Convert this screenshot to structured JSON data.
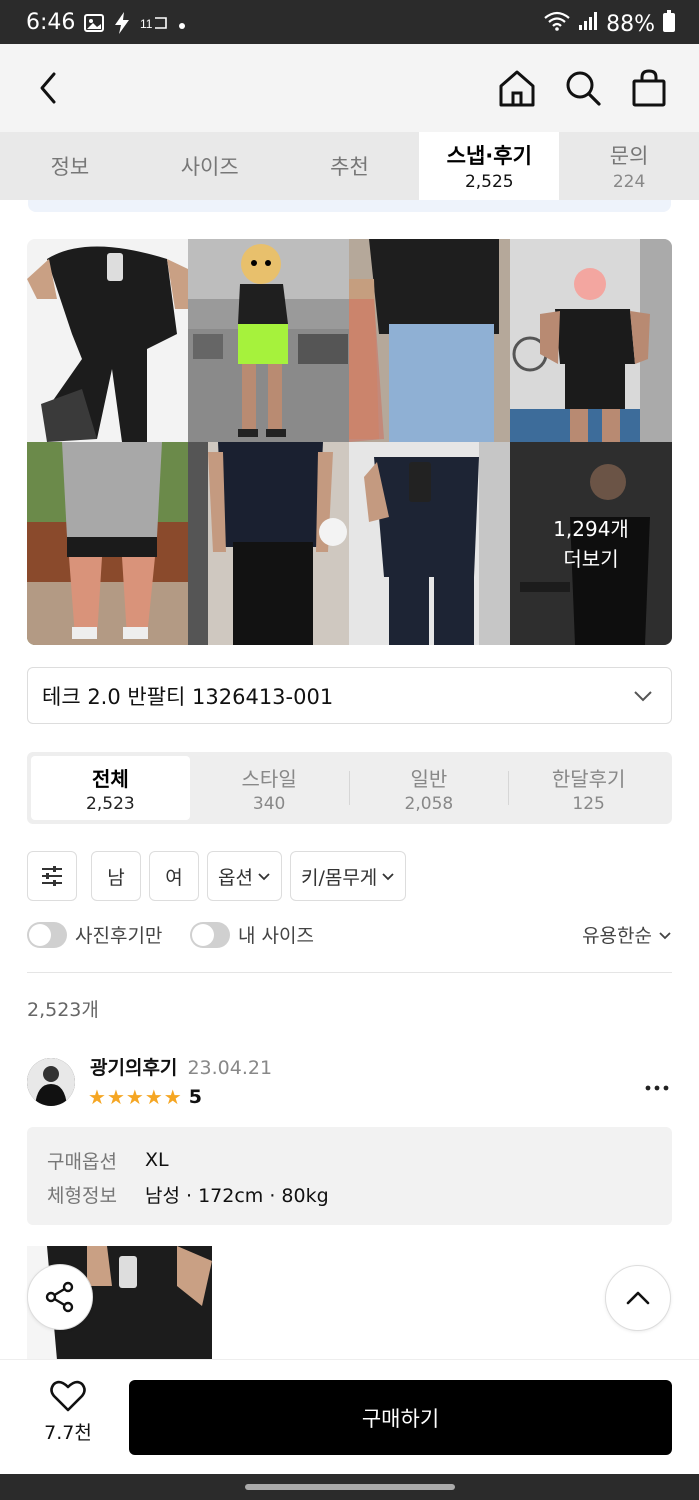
{
  "status_bar": {
    "time": "6:46",
    "battery": "88%",
    "left_icons": [
      "image-icon",
      "bolt-icon",
      "11st-icon",
      "dot-icon"
    ],
    "right_icons": [
      "wifi-icon",
      "signal-icon",
      "battery-icon"
    ]
  },
  "header": {
    "icons": [
      "back-icon",
      "home-icon",
      "search-icon",
      "bag-icon"
    ]
  },
  "tabs": [
    {
      "label": "정보",
      "count": ""
    },
    {
      "label": "사이즈",
      "count": ""
    },
    {
      "label": "추천",
      "count": ""
    },
    {
      "label": "스냅·후기",
      "count": "2,525"
    },
    {
      "label": "문의",
      "count": "224"
    }
  ],
  "photo_grid": {
    "more_count": "1,294개",
    "more_label": "더보기"
  },
  "product_select": {
    "value": "테크 2.0 반팔티 1326413-001"
  },
  "review_tabs": [
    {
      "label": "전체",
      "count": "2,523"
    },
    {
      "label": "스타일",
      "count": "340"
    },
    {
      "label": "일반",
      "count": "2,058"
    },
    {
      "label": "한달후기",
      "count": "125"
    }
  ],
  "filters": {
    "male": "남",
    "female": "여",
    "option": "옵션",
    "height_weight": "키/몸무게"
  },
  "toggles": {
    "photo_only": "사진후기만",
    "my_size": "내 사이즈",
    "sort": "유용한순"
  },
  "total_count": "2,523개",
  "review": {
    "name": "광기의후기",
    "date": "23.04.21",
    "stars": 5,
    "score": "5",
    "info": [
      {
        "key": "구매옵션",
        "value": "XL"
      },
      {
        "key": "체형정보",
        "value": "남성 · 172cm · 80kg"
      }
    ]
  },
  "bottom_bar": {
    "like_count": "7.7천",
    "buy_label": "구매하기"
  },
  "colors": {
    "accent": "#000000",
    "star": "#f5a623",
    "tab_bg": "#e9e9e9"
  }
}
